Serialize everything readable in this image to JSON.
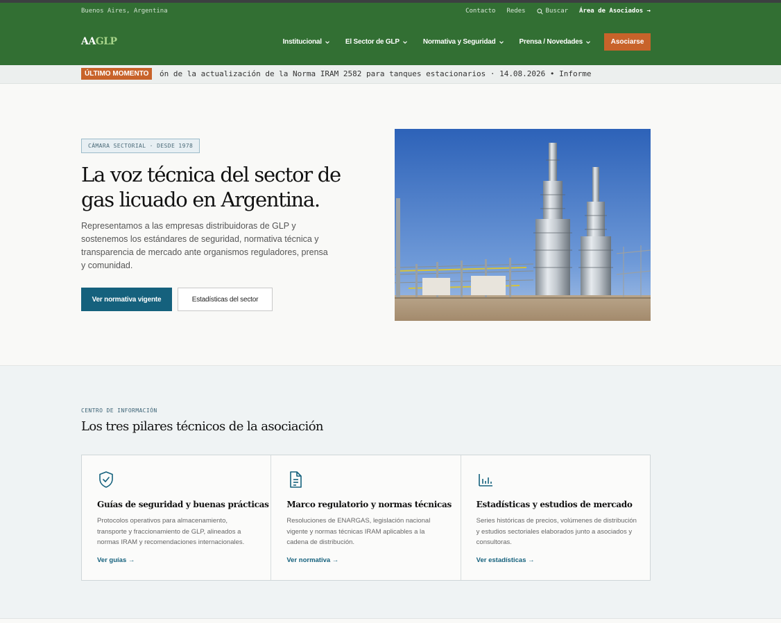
{
  "utility": {
    "location": "Buenos Aires, Argentina",
    "contact": "Contacto",
    "social": "Redes",
    "search": "Buscar",
    "members_area": "Área de Asociados →"
  },
  "logo": {
    "part1": "AA",
    "part2": "GLP"
  },
  "nav": {
    "items": [
      {
        "label": "Institucional"
      },
      {
        "label": "El Sector de GLP"
      },
      {
        "label": "Normativa y Seguridad"
      },
      {
        "label": "Prensa / Novedades"
      }
    ],
    "cta": "Asociarse"
  },
  "ticker": {
    "badge": "ÚLTIMO MOMENTO",
    "text": "ón de la actualización de la Norma IRAM 2582 para tanques estacionarios · 14.08.2026   •   Informe"
  },
  "hero": {
    "eyebrow": "CÁMARA SECTORIAL · DESDE 1978",
    "title": "La voz técnica del sector de gas licuado en Argentina.",
    "lead": "Representamos a las empresas distribuidoras de GLP y sostenemos los estándares de seguridad, normativa técnica y transparencia de mercado ante organismos reguladores, prensa y comunidad.",
    "primary_button": "Ver normativa vigente",
    "secondary_button": "Estadísticas del sector"
  },
  "pillars": {
    "kicker": "CENTRO DE INFORMACIÓN",
    "title": "Los tres pilares técnicos de la asociación",
    "cards": [
      {
        "icon": "shield-check-icon",
        "title": "Guías de seguridad y buenas prácticas",
        "text": "Protocolos operativos para almacenamiento, transporte y fraccionamiento de GLP, alineados a normas IRAM y recomendaciones internacionales.",
        "link": "Ver guías →"
      },
      {
        "icon": "document-icon",
        "title": "Marco regulatorio y normas técnicas",
        "text": "Resoluciones de ENARGAS, legislación nacional vigente y normas técnicas IRAM aplicables a la cadena de distribución.",
        "link": "Ver normativa →"
      },
      {
        "icon": "bar-chart-icon",
        "title": "Estadísticas y estudios de mercado",
        "text": "Series históricas de precios, volúmenes de distribución y estudios sectoriales elaborados junto a asociados y consultoras.",
        "link": "Ver estadísticas →"
      }
    ]
  },
  "colors": {
    "header_green": "#326f33",
    "accent_orange": "#c8632a",
    "primary_blue": "#15617d"
  }
}
